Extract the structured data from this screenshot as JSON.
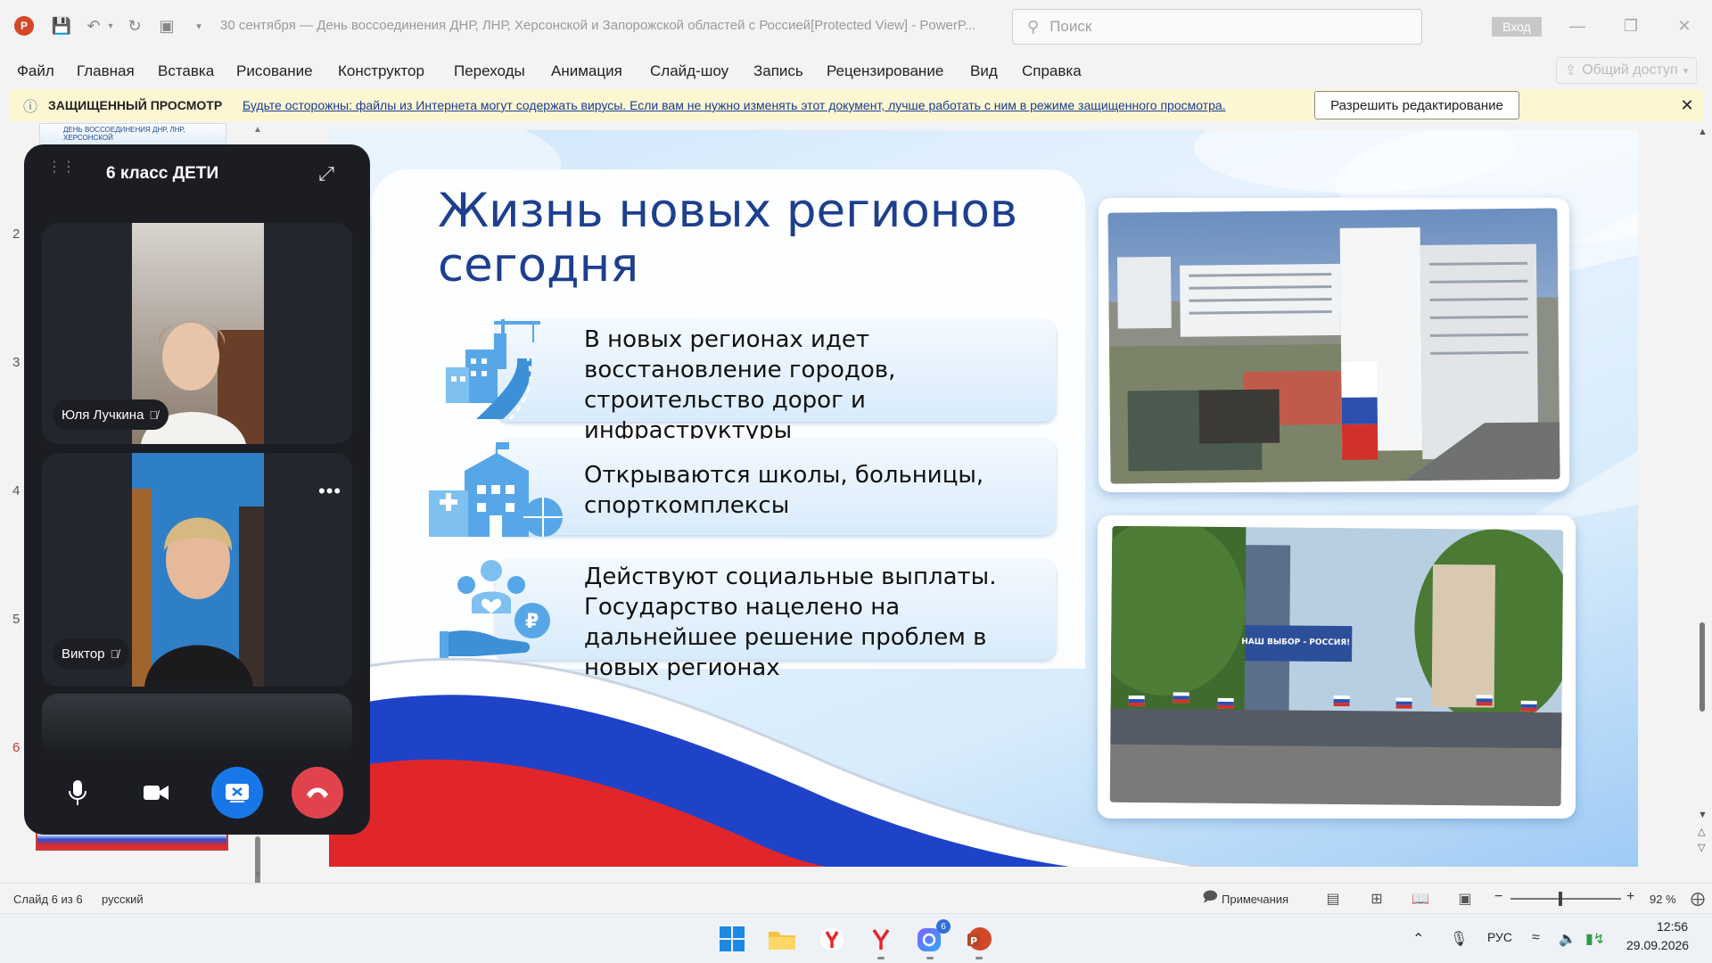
{
  "window": {
    "app_logo": "P",
    "title": "30 сентября — День воссоединения ДНР, ЛНР, Херсонской и Запорожской областей с Россией[Protected View]  -  PowerP...",
    "search_placeholder": "Поиск",
    "signin_label": "Вход",
    "share_label": "Общий доступ"
  },
  "menu": {
    "items": [
      "Файл",
      "Главная",
      "Вставка",
      "Рисование",
      "Конструктор",
      "Переходы",
      "Анимация",
      "Слайд-шоу",
      "Запись",
      "Рецензирование",
      "Вид",
      "Справка"
    ]
  },
  "protected_view": {
    "title": "ЗАЩИЩЕННЫЙ ПРОСМОТР",
    "message": "Будьте осторожны: файлы из Интернета могут содержать вирусы. Если вам не нужно изменять этот документ, лучше работать с ним в режиме защищенного просмотра.",
    "button_label": "Разрешить редактирование"
  },
  "thumbnails": {
    "numbers": [
      "2",
      "3",
      "4",
      "5",
      "6"
    ],
    "top_thumb_text": "ДЕНЬ ВОССОЕДИНЕНИЯ ДНР, ЛНР, ХЕРСОНСКОЙ"
  },
  "slide": {
    "title": "Жизнь новых регионов сегодня",
    "bullets": [
      {
        "text": "В новых регионах идет восстановление городов, строительство дорог и инфраструктуры",
        "icon": "city-road-icon"
      },
      {
        "text": "Открываются школы, больницы, спорткомплексы",
        "icon": "school-hospital-icon"
      },
      {
        "text": "Действуют социальные выплаты. Государство нацелено на дальнейшее решение проблем в новых регионах",
        "icon": "social-payment-icon"
      }
    ],
    "photo2_banner": "НАШ ВЫБОР - РОССИЯ!",
    "colors": {
      "title": "#1d3f8e",
      "flag_white": "#ffffff",
      "flag_blue": "#1e43c9",
      "flag_red": "#e0262b"
    }
  },
  "call": {
    "title": "6 класс ДЕТИ",
    "participants": [
      {
        "name": "Юля Лучкина",
        "muted": true
      },
      {
        "name": "Виктор",
        "muted": true
      }
    ],
    "more_label": "•••"
  },
  "status": {
    "slide_info": "Слайд 6 из 6",
    "language": "русский",
    "notes_label": "Примечания",
    "zoom_minus": "−",
    "zoom_plus": "+",
    "zoom": "92 %",
    "zoom_level_percent": 92
  },
  "taskbar": {
    "badge": "6",
    "tray_language": "РУС",
    "time": "12:56",
    "date": "29.09.2026"
  }
}
